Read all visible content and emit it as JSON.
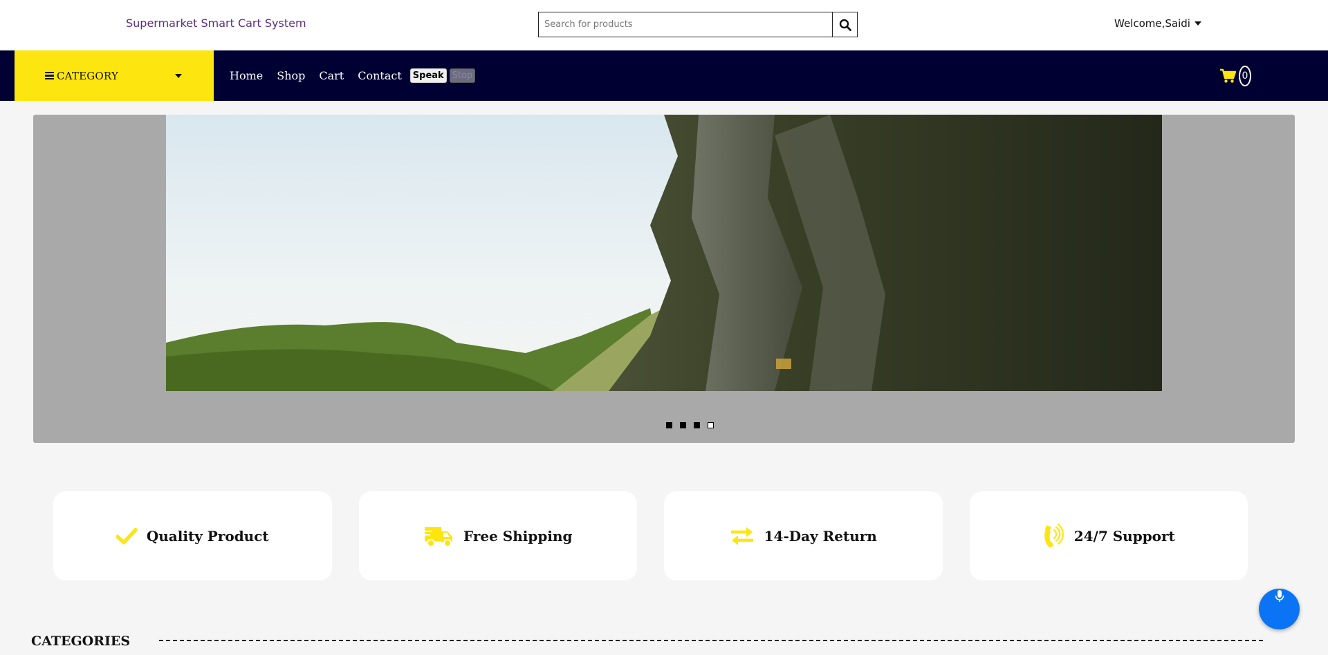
{
  "header": {
    "brand": "Supermarket Smart Cart System",
    "search_placeholder": "Search for products",
    "welcome": "Welcome,Saidi"
  },
  "nav": {
    "category_label": "CATEGORY",
    "links": [
      "Home",
      "Shop",
      "Cart",
      "Contact"
    ],
    "speak_label": "Speak",
    "stop_label": "Stop",
    "cart_count": "0"
  },
  "carousel": {
    "slides": 4,
    "active_slide": 4
  },
  "features": [
    {
      "icon": "check-icon",
      "label": "Quality Product"
    },
    {
      "icon": "shipping-truck-icon",
      "label": "Free Shipping"
    },
    {
      "icon": "exchange-arrows-icon",
      "label": "14-Day Return"
    },
    {
      "icon": "phone-volume-icon",
      "label": "24/7 Support"
    }
  ],
  "sections": {
    "categories_title": "CATEGORIES"
  },
  "colors": {
    "accent_yellow": "#fde610",
    "navbar_bg": "#000033",
    "brand_purple": "#5b2a86",
    "carousel_bg": "#a9a9a9",
    "mic_blue": "#0b74f5"
  }
}
